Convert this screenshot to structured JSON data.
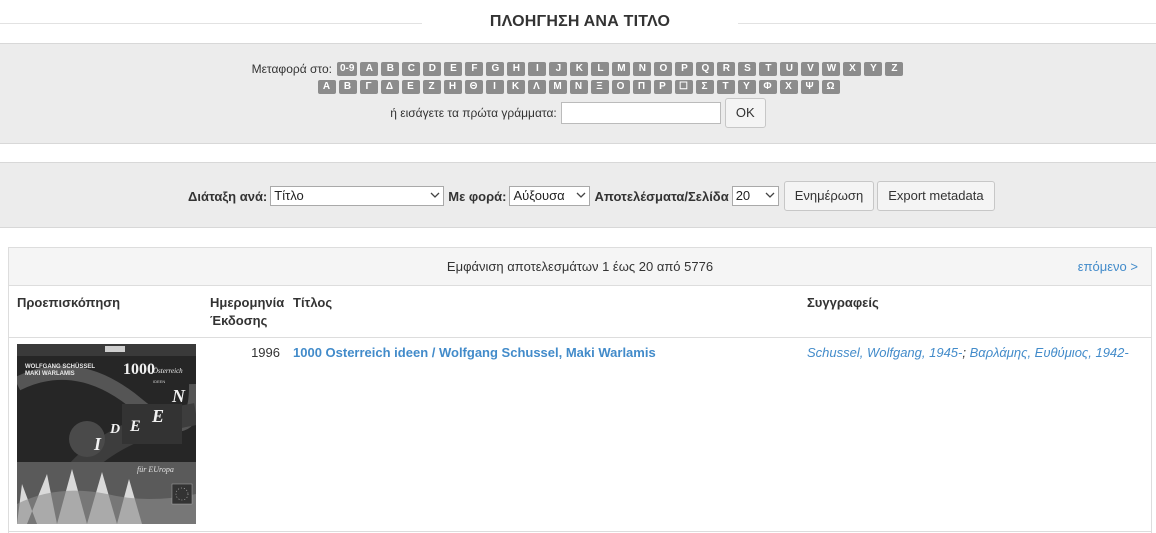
{
  "header": {
    "title": "ΠΛΟΗΓΗΣΗ ΑΝΑ ΤΙΤΛΟ"
  },
  "browse": {
    "jump_label": "Μεταφορά στο:",
    "latin_letters": [
      "0-9",
      "A",
      "B",
      "C",
      "D",
      "E",
      "F",
      "G",
      "H",
      "I",
      "J",
      "K",
      "L",
      "M",
      "N",
      "O",
      "P",
      "Q",
      "R",
      "S",
      "T",
      "U",
      "V",
      "W",
      "X",
      "Y",
      "Z"
    ],
    "greek_letters": [
      "Α",
      "Β",
      "Γ",
      "Δ",
      "Ε",
      "Ζ",
      "Η",
      "Θ",
      "Ι",
      "Κ",
      "Λ",
      "Μ",
      "Ν",
      "Ξ",
      "Ο",
      "Π",
      "Ρ",
      "☐",
      "Σ",
      "Τ",
      "Υ",
      "Φ",
      "Χ",
      "Ψ",
      "Ω"
    ],
    "starts_with_label": "ή εισάγετε τα πρώτα γράμματα:",
    "starts_with_value": "",
    "ok_label": "OK"
  },
  "sort": {
    "sort_by_label": "Διάταξη ανά:",
    "sort_by_value": "Τίτλο",
    "order_label": "Με φορά:",
    "order_value": "Αύξουσα",
    "rpp_label": "Αποτελέσματα/Σελίδα",
    "rpp_value": "20",
    "update_label": "Ενημέρωση",
    "export_label": "Export metadata"
  },
  "results": {
    "summary": "Εμφάνιση αποτελεσμάτων 1 έως 20 από 5776",
    "next_label": "επόμενο >",
    "columns": {
      "preview": "Προεπισκόπηση",
      "date": "Ημερομηνία Έκδοσης",
      "title": "Τίτλος",
      "authors": "Συγγραφείς"
    },
    "rows": [
      {
        "date": "1996",
        "title": "1000 Osterreich ideen / Wolfgang Schussel, Maki Warlamis",
        "author1": "Schussel, Wolfgang, 1945-",
        "separator": ";",
        "author2": "Βαρλάμης, Ευθύμιος, 1942-",
        "cover": {
          "authors_line1": "WOLFGANG SCHÜSSEL",
          "authors_line2": "MAKI WARLAMIS",
          "number": "1000",
          "word1": "Österreich",
          "word2": "IDEEN",
          "subtitle": "für EUropa"
        }
      }
    ]
  }
}
